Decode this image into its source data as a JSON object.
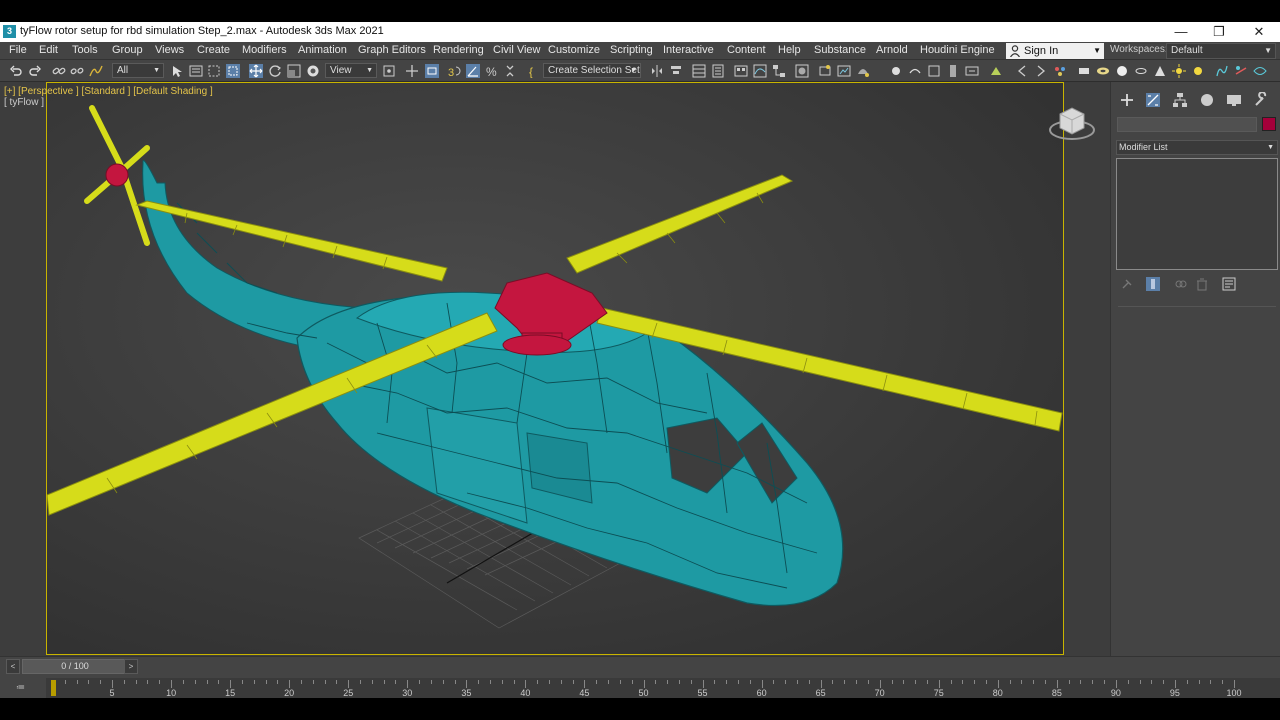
{
  "window": {
    "title": "tyFlow rotor setup for rbd simulation Step_2.max - Autodesk 3ds Max 2021",
    "app_icon_text": "3"
  },
  "menubar": {
    "items": [
      "File",
      "Edit",
      "Tools",
      "Group",
      "Views",
      "Create",
      "Modifiers",
      "Animation",
      "Graph Editors",
      "Rendering",
      "Civil View",
      "Customize",
      "Scripting",
      "Interactive",
      "Content",
      "Help",
      "Substance",
      "Arnold",
      "Houdini Engine"
    ],
    "sign_in": "Sign In",
    "workspaces_label": "Workspaces:",
    "workspace_value": "Default"
  },
  "toolbar": {
    "selection_filter": "All",
    "ref_coord": "View",
    "named_selection": "Create Selection Set"
  },
  "viewport": {
    "label": "[+] [Perspective ] [Standard ] [Default Shading ]",
    "sub_label": "[ tyFlow ]",
    "colors": {
      "fuselage": "#1e9aa3",
      "blades": "#d6dc1a",
      "rotor_hub": "#c4163f",
      "active_border": "#c8b400"
    }
  },
  "command_panel": {
    "modifier_list": "Modifier List",
    "object_color": "#a4003a"
  },
  "timeline": {
    "frame_display": "0 / 100",
    "current_frame": 0,
    "tick_labels": [
      "0",
      "5",
      "10",
      "15",
      "20",
      "25",
      "30",
      "35",
      "40",
      "45",
      "50",
      "55",
      "60",
      "65",
      "70",
      "75",
      "80",
      "85",
      "90",
      "95",
      "100"
    ]
  }
}
